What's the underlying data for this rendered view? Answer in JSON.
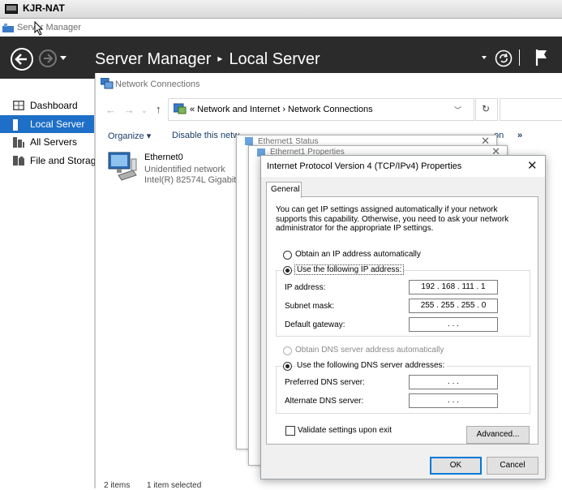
{
  "vm": {
    "title": "KJR-NAT"
  },
  "server_manager": {
    "window_title": "Server Manager",
    "breadcrumb_root": "Server Manager",
    "breadcrumb_sep": "▸",
    "breadcrumb_current": "Local Server",
    "sidebar": [
      {
        "label": "Dashboard",
        "icon": "dashboard-icon",
        "selected": false
      },
      {
        "label": "Local Server",
        "icon": "local-server-icon",
        "selected": true
      },
      {
        "label": "All Servers",
        "icon": "all-servers-icon",
        "selected": false
      },
      {
        "label": "File and Storag",
        "icon": "file-storage-icon",
        "selected": false
      }
    ]
  },
  "network_connections": {
    "window_title": "Network Connections",
    "address_path": "« Network and Internet  ›  Network Connections",
    "toolbar": {
      "organize": "Organize ▾",
      "disable": "Disable this netw",
      "more_on": "on",
      "overflow": "»"
    },
    "item": {
      "name": "Ethernet0",
      "status": "Unidentified network",
      "adapter": "Intel(R) 82574L Gigabit N"
    },
    "status_bar": {
      "count": "2 items",
      "selection": "1 item selected"
    }
  },
  "background_dialogs": {
    "status_title": "Ethernet1 Status",
    "properties_title": "Ethernet1 Properties"
  },
  "dialog": {
    "title": "Internet Protocol Version 4 (TCP/IPv4) Properties",
    "tab": "General",
    "description": "You can get IP settings assigned automatically if your network supports this capability. Otherwise, you need to ask your network administrator for the appropriate IP settings.",
    "ip_mode": {
      "auto_label": "Obtain an IP address automatically",
      "manual_label": "Use the following IP address:",
      "selected": "manual"
    },
    "fields": {
      "ip_address": {
        "label": "IP address:",
        "value": "192 . 168 . 111 .  1"
      },
      "subnet_mask": {
        "label": "Subnet mask:",
        "value": "255 . 255 . 255 .  0"
      },
      "default_gateway": {
        "label": "Default gateway:",
        "value": ".        .        ."
      }
    },
    "dns_mode": {
      "auto_label": "Obtain DNS server address automatically",
      "manual_label": "Use the following DNS server addresses:",
      "selected": "manual"
    },
    "dns_fields": {
      "preferred": {
        "label": "Preferred DNS server:",
        "value": ".        .        ."
      },
      "alternate": {
        "label": "Alternate DNS server:",
        "value": ".        .        ."
      }
    },
    "validate_label": "Validate settings upon exit",
    "validate_checked": false,
    "advanced_label": "Advanced...",
    "ok_label": "OK",
    "cancel_label": "Cancel"
  },
  "colors": {
    "accent": "#1e6fc7",
    "header_bg": "#2b2b2b",
    "focus_blue": "#0078d7"
  }
}
